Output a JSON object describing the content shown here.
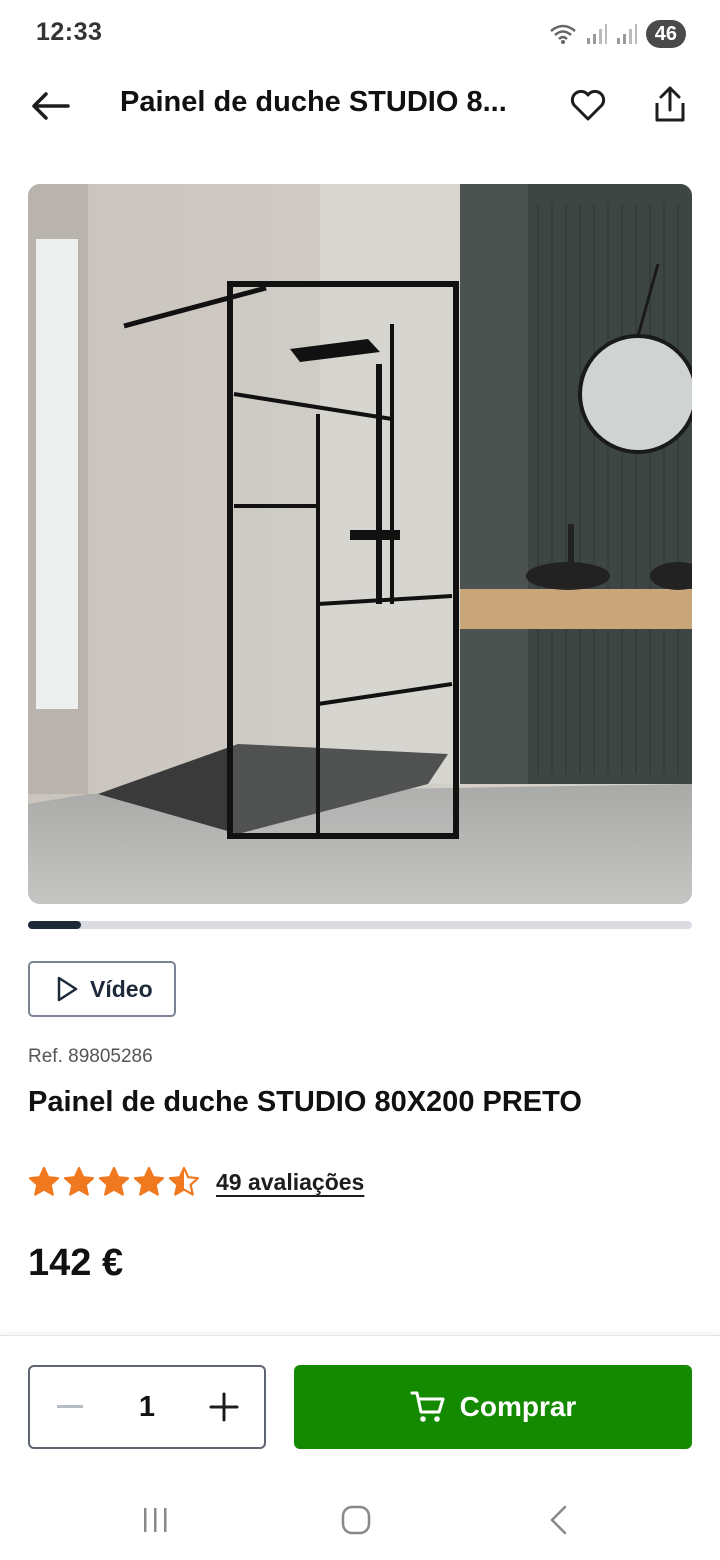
{
  "status_bar": {
    "time": "12:33",
    "battery": "46",
    "icons": [
      "wifi-icon",
      "signal-icon",
      "signal-icon-2",
      "battery-icon"
    ]
  },
  "header": {
    "title": "Painel de duche STUDIO 8...",
    "back_icon": "arrow-left-icon",
    "favorite_icon": "heart-icon",
    "share_icon": "share-icon"
  },
  "gallery": {
    "image_description_icon": "product-photo",
    "carousel_progress": 0.08
  },
  "video_button": {
    "label": "Vídeo",
    "icon": "play-icon"
  },
  "product": {
    "ref": "Ref. 89805286",
    "title": "Painel de duche STUDIO 80X200 PRETO",
    "rating": 4.5,
    "rating_max": 5,
    "reviews_label": "49 avaliações",
    "price": "142 €"
  },
  "colors": {
    "star": "#f0791f",
    "buy_button": "#148a00",
    "carousel_active": "#1e2a3a",
    "carousel_track": "#d9dbe0"
  },
  "action_bar": {
    "quantity": "1",
    "minus_icon": "minus-icon",
    "plus_icon": "plus-icon",
    "buy_label": "Comprar",
    "buy_icon": "cart-icon"
  },
  "nav_bar": {
    "icons": [
      "recent-apps-icon",
      "home-icon",
      "back-icon"
    ]
  }
}
